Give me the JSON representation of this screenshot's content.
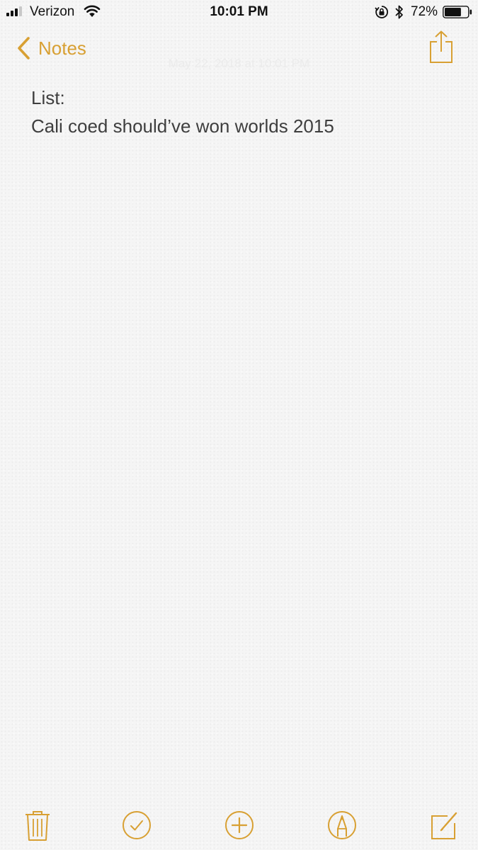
{
  "status_bar": {
    "carrier": "Verizon",
    "time": "10:01 PM",
    "battery_percent": "72%",
    "battery_level": 0.72,
    "signal_bars": 3,
    "icons": [
      "signal-icon",
      "wifi-icon",
      "rotation-lock-icon",
      "bluetooth-icon",
      "battery-icon"
    ]
  },
  "nav": {
    "back_label": "Notes",
    "date_ghost": "May 22, 2018 at 10:01 PM",
    "share_icon": "share-icon"
  },
  "note": {
    "lines": [
      "List:",
      "Cali coed should’ve won worlds 2015"
    ]
  },
  "toolbar": {
    "items": [
      "trash-icon",
      "checklist-icon",
      "add-icon",
      "markup-icon",
      "compose-icon"
    ]
  },
  "colors": {
    "accent": "#d8a033",
    "text": "#3e3e3e",
    "background": "#f5f5f5"
  }
}
